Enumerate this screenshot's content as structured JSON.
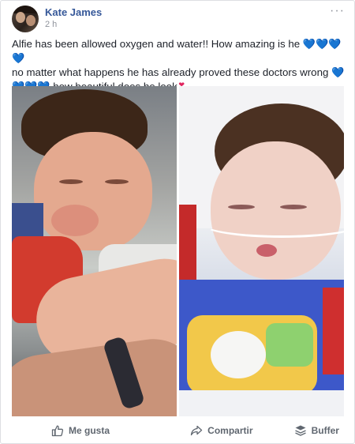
{
  "post": {
    "author": "Kate James",
    "timestamp": "2 h",
    "more_label": "···",
    "text_line1": "Alfie has been allowed oxygen and water!! How amazing is he ",
    "text_line2": " no matter what happens he has already proved these doctors wrong ",
    "text_line3": " how beautiful does he look",
    "blue_hearts_1": "💙💙💙💙",
    "blue_hearts_2": "💙",
    "blue_hearts_3": "💙💙💙",
    "red_heart": "❣"
  },
  "actions": {
    "like_label": "Me gusta",
    "share_label": "Compartir",
    "buffer_label": "Buffer"
  },
  "icons": {
    "like": "thumbs-up-icon",
    "share": "share-arrow-icon",
    "buffer": "buffer-stack-icon",
    "more": "more-dots-icon"
  },
  "colors": {
    "author": "#365899",
    "action_text": "#606770",
    "blue_heart": "#4a8df5",
    "red_heart": "#e0245e"
  }
}
